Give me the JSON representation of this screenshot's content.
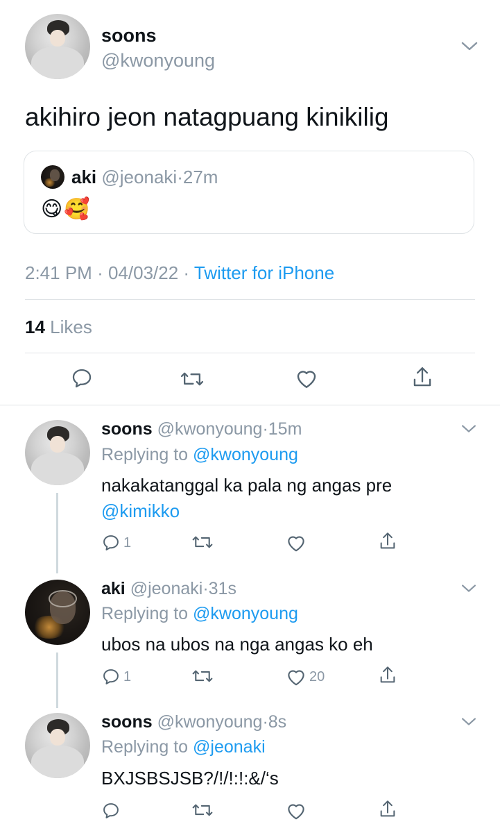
{
  "main_tweet": {
    "author_name": "soons",
    "author_handle": "@kwonyoung",
    "text": "akihiro jeon natagpuang kinikilig",
    "quoted": {
      "author_name": "aki",
      "author_handle": "@jeonaki",
      "separator": "·",
      "time": "27m",
      "text": "😋🥰"
    },
    "time": "2:41 PM",
    "sep1": "·",
    "date": "04/03/22",
    "sep2": "·",
    "source": "Twitter for iPhone",
    "likes_count": "14",
    "likes_label": "Likes"
  },
  "replies": [
    {
      "author_name": "soons",
      "author_handle": "@kwonyoung",
      "separator": "·",
      "time": "15m",
      "replying_label": "Replying to",
      "replying_to": "@kwonyoung",
      "text": "nakakatanggal ka pala ng angas pre",
      "mention": "@kimikko",
      "reply_count": "1",
      "like_count": ""
    },
    {
      "author_name": "aki",
      "author_handle": "@jeonaki",
      "separator": "·",
      "time": "31s",
      "replying_label": "Replying to",
      "replying_to": "@kwonyoung",
      "text": "ubos na ubos na nga angas ko eh",
      "reply_count": "1",
      "like_count": "20"
    },
    {
      "author_name": "soons",
      "author_handle": "@kwonyoung",
      "separator": "·",
      "time": "8s",
      "replying_label": "Replying to",
      "replying_to": "@jeonaki",
      "text": "BXJSBSJSB?/!/!:!:&/‘s",
      "reply_count": "",
      "like_count": ""
    }
  ],
  "icons": {
    "chevron": "chevron-down-icon",
    "reply": "reply-icon",
    "retweet": "retweet-icon",
    "like": "heart-icon",
    "share": "share-icon"
  },
  "colors": {
    "link": "#1d9bf0",
    "secondary": "#8b98a5",
    "text": "#0f1419",
    "divider": "#dfe3e6"
  }
}
